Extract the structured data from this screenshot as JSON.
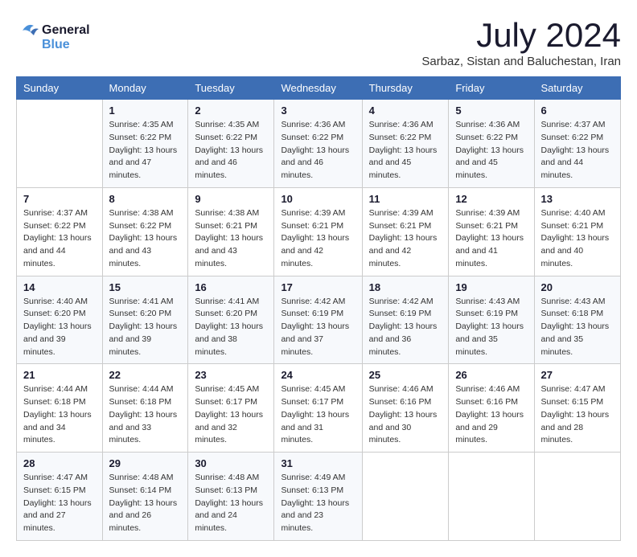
{
  "header": {
    "logo_general": "General",
    "logo_blue": "Blue",
    "month": "July 2024",
    "location": "Sarbaz, Sistan and Baluchestan, Iran"
  },
  "days_of_week": [
    "Sunday",
    "Monday",
    "Tuesday",
    "Wednesday",
    "Thursday",
    "Friday",
    "Saturday"
  ],
  "weeks": [
    [
      {
        "day": "",
        "sunrise": "",
        "sunset": "",
        "daylight": ""
      },
      {
        "day": "1",
        "sunrise": "Sunrise: 4:35 AM",
        "sunset": "Sunset: 6:22 PM",
        "daylight": "Daylight: 13 hours and 47 minutes."
      },
      {
        "day": "2",
        "sunrise": "Sunrise: 4:35 AM",
        "sunset": "Sunset: 6:22 PM",
        "daylight": "Daylight: 13 hours and 46 minutes."
      },
      {
        "day": "3",
        "sunrise": "Sunrise: 4:36 AM",
        "sunset": "Sunset: 6:22 PM",
        "daylight": "Daylight: 13 hours and 46 minutes."
      },
      {
        "day": "4",
        "sunrise": "Sunrise: 4:36 AM",
        "sunset": "Sunset: 6:22 PM",
        "daylight": "Daylight: 13 hours and 45 minutes."
      },
      {
        "day": "5",
        "sunrise": "Sunrise: 4:36 AM",
        "sunset": "Sunset: 6:22 PM",
        "daylight": "Daylight: 13 hours and 45 minutes."
      },
      {
        "day": "6",
        "sunrise": "Sunrise: 4:37 AM",
        "sunset": "Sunset: 6:22 PM",
        "daylight": "Daylight: 13 hours and 44 minutes."
      }
    ],
    [
      {
        "day": "7",
        "sunrise": "Sunrise: 4:37 AM",
        "sunset": "Sunset: 6:22 PM",
        "daylight": "Daylight: 13 hours and 44 minutes."
      },
      {
        "day": "8",
        "sunrise": "Sunrise: 4:38 AM",
        "sunset": "Sunset: 6:22 PM",
        "daylight": "Daylight: 13 hours and 43 minutes."
      },
      {
        "day": "9",
        "sunrise": "Sunrise: 4:38 AM",
        "sunset": "Sunset: 6:21 PM",
        "daylight": "Daylight: 13 hours and 43 minutes."
      },
      {
        "day": "10",
        "sunrise": "Sunrise: 4:39 AM",
        "sunset": "Sunset: 6:21 PM",
        "daylight": "Daylight: 13 hours and 42 minutes."
      },
      {
        "day": "11",
        "sunrise": "Sunrise: 4:39 AM",
        "sunset": "Sunset: 6:21 PM",
        "daylight": "Daylight: 13 hours and 42 minutes."
      },
      {
        "day": "12",
        "sunrise": "Sunrise: 4:39 AM",
        "sunset": "Sunset: 6:21 PM",
        "daylight": "Daylight: 13 hours and 41 minutes."
      },
      {
        "day": "13",
        "sunrise": "Sunrise: 4:40 AM",
        "sunset": "Sunset: 6:21 PM",
        "daylight": "Daylight: 13 hours and 40 minutes."
      }
    ],
    [
      {
        "day": "14",
        "sunrise": "Sunrise: 4:40 AM",
        "sunset": "Sunset: 6:20 PM",
        "daylight": "Daylight: 13 hours and 39 minutes."
      },
      {
        "day": "15",
        "sunrise": "Sunrise: 4:41 AM",
        "sunset": "Sunset: 6:20 PM",
        "daylight": "Daylight: 13 hours and 39 minutes."
      },
      {
        "day": "16",
        "sunrise": "Sunrise: 4:41 AM",
        "sunset": "Sunset: 6:20 PM",
        "daylight": "Daylight: 13 hours and 38 minutes."
      },
      {
        "day": "17",
        "sunrise": "Sunrise: 4:42 AM",
        "sunset": "Sunset: 6:19 PM",
        "daylight": "Daylight: 13 hours and 37 minutes."
      },
      {
        "day": "18",
        "sunrise": "Sunrise: 4:42 AM",
        "sunset": "Sunset: 6:19 PM",
        "daylight": "Daylight: 13 hours and 36 minutes."
      },
      {
        "day": "19",
        "sunrise": "Sunrise: 4:43 AM",
        "sunset": "Sunset: 6:19 PM",
        "daylight": "Daylight: 13 hours and 35 minutes."
      },
      {
        "day": "20",
        "sunrise": "Sunrise: 4:43 AM",
        "sunset": "Sunset: 6:18 PM",
        "daylight": "Daylight: 13 hours and 35 minutes."
      }
    ],
    [
      {
        "day": "21",
        "sunrise": "Sunrise: 4:44 AM",
        "sunset": "Sunset: 6:18 PM",
        "daylight": "Daylight: 13 hours and 34 minutes."
      },
      {
        "day": "22",
        "sunrise": "Sunrise: 4:44 AM",
        "sunset": "Sunset: 6:18 PM",
        "daylight": "Daylight: 13 hours and 33 minutes."
      },
      {
        "day": "23",
        "sunrise": "Sunrise: 4:45 AM",
        "sunset": "Sunset: 6:17 PM",
        "daylight": "Daylight: 13 hours and 32 minutes."
      },
      {
        "day": "24",
        "sunrise": "Sunrise: 4:45 AM",
        "sunset": "Sunset: 6:17 PM",
        "daylight": "Daylight: 13 hours and 31 minutes."
      },
      {
        "day": "25",
        "sunrise": "Sunrise: 4:46 AM",
        "sunset": "Sunset: 6:16 PM",
        "daylight": "Daylight: 13 hours and 30 minutes."
      },
      {
        "day": "26",
        "sunrise": "Sunrise: 4:46 AM",
        "sunset": "Sunset: 6:16 PM",
        "daylight": "Daylight: 13 hours and 29 minutes."
      },
      {
        "day": "27",
        "sunrise": "Sunrise: 4:47 AM",
        "sunset": "Sunset: 6:15 PM",
        "daylight": "Daylight: 13 hours and 28 minutes."
      }
    ],
    [
      {
        "day": "28",
        "sunrise": "Sunrise: 4:47 AM",
        "sunset": "Sunset: 6:15 PM",
        "daylight": "Daylight: 13 hours and 27 minutes."
      },
      {
        "day": "29",
        "sunrise": "Sunrise: 4:48 AM",
        "sunset": "Sunset: 6:14 PM",
        "daylight": "Daylight: 13 hours and 26 minutes."
      },
      {
        "day": "30",
        "sunrise": "Sunrise: 4:48 AM",
        "sunset": "Sunset: 6:13 PM",
        "daylight": "Daylight: 13 hours and 24 minutes."
      },
      {
        "day": "31",
        "sunrise": "Sunrise: 4:49 AM",
        "sunset": "Sunset: 6:13 PM",
        "daylight": "Daylight: 13 hours and 23 minutes."
      },
      {
        "day": "",
        "sunrise": "",
        "sunset": "",
        "daylight": ""
      },
      {
        "day": "",
        "sunrise": "",
        "sunset": "",
        "daylight": ""
      },
      {
        "day": "",
        "sunrise": "",
        "sunset": "",
        "daylight": ""
      }
    ]
  ]
}
